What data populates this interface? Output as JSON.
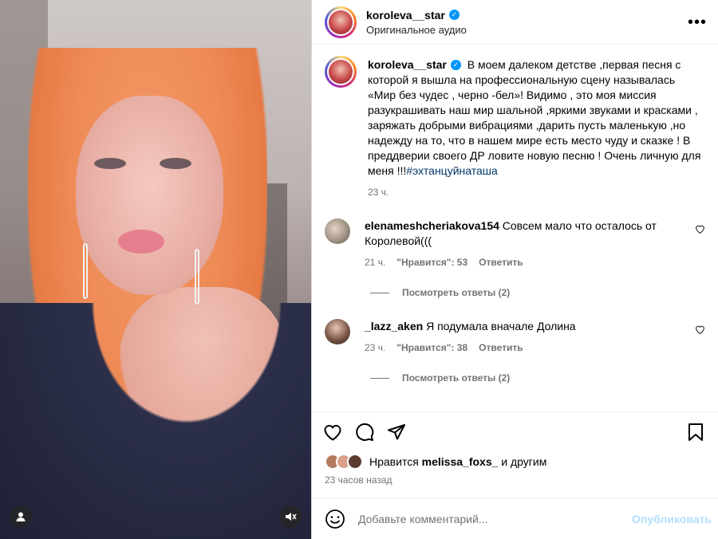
{
  "header": {
    "username": "koroleva__star",
    "subtitle": "Оригинальное аудио"
  },
  "caption": {
    "username": "koroleva__star",
    "text": "В моем далеком детстве ,первая песня с которой я вышла на профессиональную сцену называлась «Мир без чудес , черно -бел»! Видимо , это моя миссия разукрашивать наш мир шальной ,яркими звуками и красками , заряжать добрыми вибрациями ,дарить пусть маленькую ,но надежду на то, что в нашем мире есть место чуду и сказке ! В преддверии своего ДР ловите новую песню ! Очень личную для меня !!!",
    "hashtag": "#эхтанцуйнаташа",
    "time": "23 ч."
  },
  "comments": [
    {
      "username": "elenameshcheriakova154",
      "text": "Совсем мало что осталось от Королевой(((",
      "time": "21 ч.",
      "likes": "\"Нравится\": 53",
      "reply": "Ответить",
      "view_replies": "Посмотреть ответы (2)"
    },
    {
      "username": "_lazz_aken",
      "text": "Я подумала вначале Долина",
      "time": "23 ч.",
      "likes": "\"Нравится\": 38",
      "reply": "Ответить",
      "view_replies": "Посмотреть ответы (2)"
    }
  ],
  "likes_line": {
    "prefix": "Нравится",
    "user": "melissa_foxs_",
    "suffix": "и другим"
  },
  "post_time": "23 часов назад",
  "add_comment": {
    "placeholder": "Добавьте комментарий...",
    "post_label": "Опубликовать"
  },
  "icons": {
    "like": "heart-icon",
    "comment": "comment-icon",
    "share": "share-icon",
    "save": "bookmark-icon",
    "more": "more-icon",
    "emoji": "emoji-icon",
    "mute": "mute-icon",
    "user_tag": "user-icon"
  },
  "colors": {
    "verified": "#0095f6",
    "hashtag": "#00376b",
    "secondary_text": "#737373",
    "post_disabled": "#b2dffc"
  }
}
